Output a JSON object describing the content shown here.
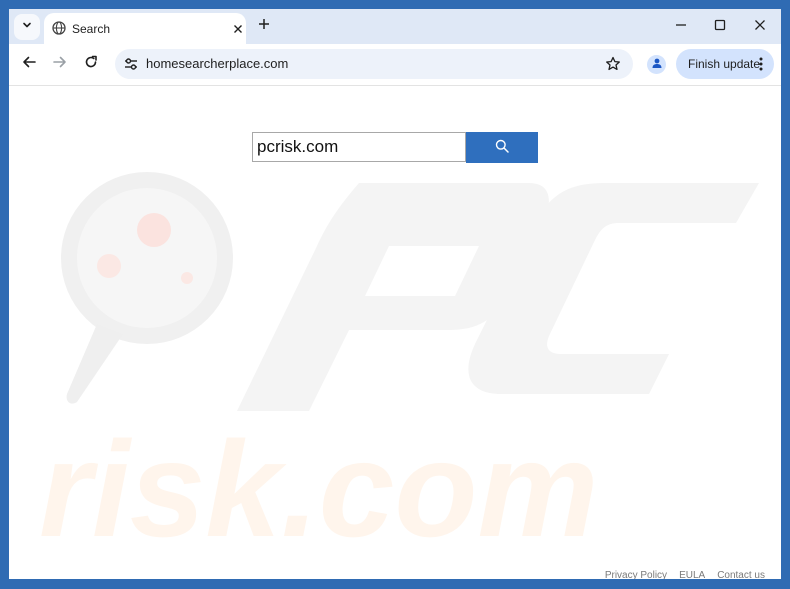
{
  "browser": {
    "tab": {
      "title": "Search",
      "favicon": "globe-icon"
    },
    "address_bar": {
      "url": "homesearcherplace.com"
    },
    "finish_update_label": "Finish update",
    "colors": {
      "frame": "#2f6bb3",
      "tabstrip": "#dfe8f6",
      "omnibox": "#edf2fa",
      "chip": "#d3e3fd"
    }
  },
  "page": {
    "search": {
      "value": "pcrisk.com",
      "button_icon": "search-icon",
      "button_color": "#2f6fbe"
    },
    "footer": {
      "links": [
        "Privacy Policy",
        "EULA",
        "Contact us"
      ]
    }
  }
}
